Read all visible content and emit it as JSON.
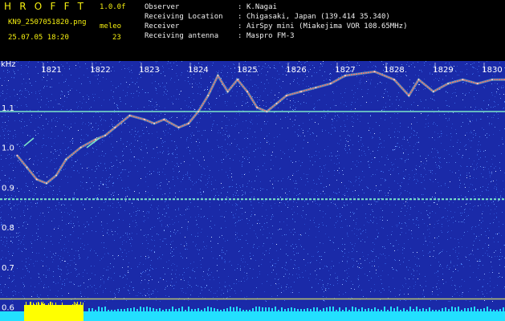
{
  "app": {
    "logo": "H R O F F T",
    "version": "1.0.0f"
  },
  "file": {
    "name": "KN9_2507051820.png",
    "timestamp": "25.07.05 18:20"
  },
  "meleo": {
    "label": "meleo",
    "value": "23"
  },
  "info": [
    {
      "label": "Observer",
      "value": "K.Nagai"
    },
    {
      "label": "Receiving Location",
      "value": "Chigasaki, Japan (139.414 35.340)"
    },
    {
      "label": "Receiver",
      "value": "AirSpy mini (Miakejima VOR 108.65MHz)"
    },
    {
      "label": "Receiving antenna",
      "value": "Maspro FM-3"
    }
  ],
  "chart_data": {
    "type": "heatmap",
    "xlabel": "",
    "ylabel": "kHz",
    "x_ticks": [
      "1821",
      "1822",
      "1823",
      "1824",
      "1825",
      "1826",
      "1827",
      "1828",
      "1829",
      "1830"
    ],
    "y_ticks": [
      "1.1",
      "1.0",
      "0.9",
      "0.8",
      "0.7",
      "0.6"
    ],
    "ylim": [
      0.59,
      1.19
    ],
    "colors": {
      "background": "#1a2aa8",
      "noise": [
        "#2b4fd0",
        "#3a6ae8",
        "#5a8cf0",
        "#8fb0ff",
        "#c8d8ff"
      ],
      "signal": "#ff6a6a",
      "carrier": "#7de7c8",
      "bar": "#ffff00",
      "bottom": "#22e0ff"
    },
    "carriers_khz": [
      1.09,
      0.87,
      0.62
    ],
    "trace": {
      "points": [
        [
          1820.3,
          0.98
        ],
        [
          1820.5,
          0.95
        ],
        [
          1820.7,
          0.92
        ],
        [
          1820.9,
          0.91
        ],
        [
          1821.1,
          0.93
        ],
        [
          1821.3,
          0.97
        ],
        [
          1821.6,
          1.0
        ],
        [
          1821.9,
          1.02
        ],
        [
          1822.1,
          1.03
        ],
        [
          1822.3,
          1.05
        ],
        [
          1822.6,
          1.08
        ],
        [
          1822.9,
          1.07
        ],
        [
          1823.1,
          1.06
        ],
        [
          1823.3,
          1.07
        ],
        [
          1823.6,
          1.05
        ],
        [
          1823.8,
          1.06
        ],
        [
          1824.0,
          1.09
        ],
        [
          1824.2,
          1.13
        ],
        [
          1824.4,
          1.18
        ],
        [
          1824.6,
          1.14
        ],
        [
          1824.8,
          1.17
        ],
        [
          1825.0,
          1.14
        ],
        [
          1825.2,
          1.1
        ],
        [
          1825.4,
          1.09
        ],
        [
          1825.6,
          1.11
        ],
        [
          1825.8,
          1.13
        ],
        [
          1826.1,
          1.14
        ],
        [
          1826.4,
          1.15
        ],
        [
          1826.7,
          1.16
        ],
        [
          1827.0,
          1.18
        ],
        [
          1827.6,
          1.19
        ],
        [
          1828.0,
          1.17
        ],
        [
          1828.3,
          1.13
        ],
        [
          1828.5,
          1.17
        ],
        [
          1828.8,
          1.14
        ],
        [
          1829.1,
          1.16
        ],
        [
          1829.4,
          1.17
        ],
        [
          1829.7,
          1.16
        ],
        [
          1830.0,
          1.17
        ],
        [
          1830.3,
          1.17
        ]
      ]
    }
  }
}
